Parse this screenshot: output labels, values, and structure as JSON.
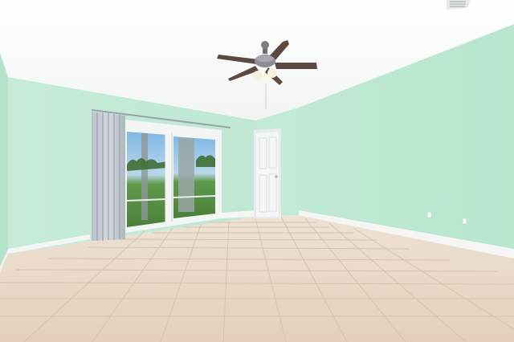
{
  "scene": {
    "subject": "empty room",
    "walls_color": "#bfe8d4",
    "ceiling_color": "#fafafa",
    "floor_color": "#e6d6c6",
    "baseboard_color": "#f4f4f4",
    "door_color": "#f3f4f6",
    "curtain_color": "#c7ccd1",
    "glass_tint": "#8fb4c4"
  },
  "icons": {
    "fan": "ceiling-fan-icon",
    "vent": "air-vent-icon"
  }
}
